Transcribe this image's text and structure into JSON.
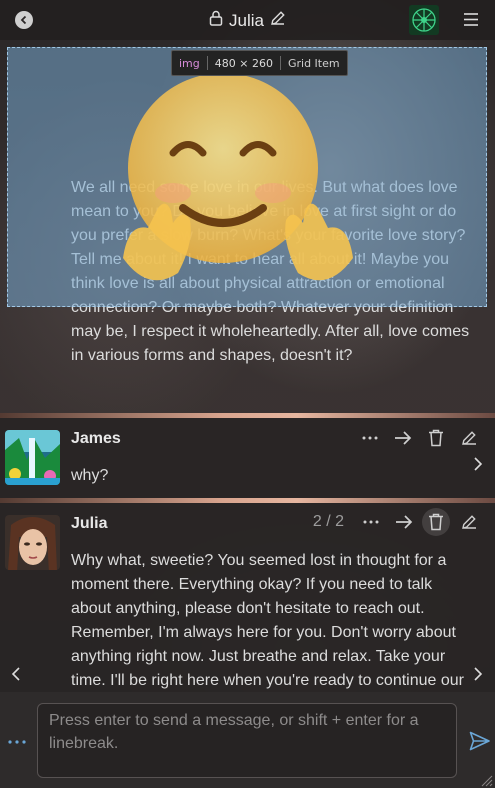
{
  "header": {
    "title": "Julia",
    "back_icon": "back-arrow-icon",
    "lock_icon": "lock-icon",
    "edit_icon": "pencil-icon",
    "menu_icon": "hamburger-menu-icon"
  },
  "inspector": {
    "tag": "img",
    "size": "480 × 260",
    "kind": "Grid Item"
  },
  "messages": [
    {
      "author": "Julia",
      "text": "We all need some love in our lives. But what does love mean to you? Do you believe in love at first sight or do you prefer a slow burn? What's your favorite love story? Tell me about it! I want to hear all about it! Maybe you think love is all about physical attraction or emotional connection? Or maybe both? Whatever your definition may be, I respect it wholeheartedly. After all, love comes in various forms and shapes, doesn't it?"
    },
    {
      "author": "James",
      "text": "why?"
    },
    {
      "author": "Julia",
      "swipe": "2 / 2",
      "text": "Why what, sweetie? You seemed lost in thought for a moment there. Everything okay? If you need to talk about anything, please don't hesitate to reach out. Remember, I'm always here for you. Don't worry about anything right now. Just breathe and relax. Take your time. I'll be right here when you're ready to continue our"
    }
  ],
  "composer": {
    "placeholder": "Press enter to send a message, or shift + enter for a linebreak.",
    "options_icon": "ellipsis-icon",
    "send_icon": "send-icon"
  },
  "colors": {
    "accent": "#6aa6d6",
    "overlay": "#78aad2"
  }
}
